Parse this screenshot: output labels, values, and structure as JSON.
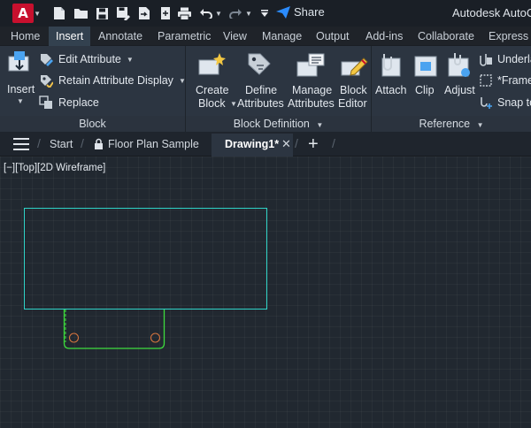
{
  "app": {
    "logo_letter": "A",
    "title": "Autodesk AutoCAD",
    "share_label": "Share"
  },
  "quick_access": [
    "new-icon",
    "open-icon",
    "save-icon",
    "save-as-icon",
    "import-icon",
    "print-icon",
    "undo-icon",
    "redo-icon",
    "customize-icon"
  ],
  "ribbon_tabs": [
    "Home",
    "Insert",
    "Annotate",
    "Parametric",
    "View",
    "Manage",
    "Output",
    "Add-ins",
    "Collaborate",
    "Express T"
  ],
  "active_tab": "Insert",
  "block_panel": {
    "insert_label": "Insert",
    "edit_attribute": "Edit Attribute",
    "retain_attribute_display": "Retain Attribute Display",
    "replace": "Replace",
    "title": "Block"
  },
  "block_definition_panel": {
    "create_block": [
      "Create",
      "Block"
    ],
    "define_attributes": [
      "Define",
      "Attributes"
    ],
    "manage_attributes": [
      "Manage",
      "Attributes"
    ],
    "block_editor": [
      "Block",
      "Editor"
    ],
    "title": "Block Definition"
  },
  "reference_panel": {
    "attach": "Attach",
    "clip": "Clip",
    "adjust": "Adjust",
    "underlay": "Underla",
    "frames": "*Frame",
    "snap": "Snap to",
    "title": "Reference"
  },
  "file_tabs": {
    "start": "Start",
    "floor_plan": "Floor Plan Sample",
    "active": "Drawing1*"
  },
  "viewport_label": "[−][Top][2D Wireframe]",
  "colors": {
    "rectangle": "#2fd4c8",
    "block_outline": "#3ddb3d",
    "circles": "#d2733e",
    "brand": "#c8102e",
    "share": "#2b8cff"
  }
}
